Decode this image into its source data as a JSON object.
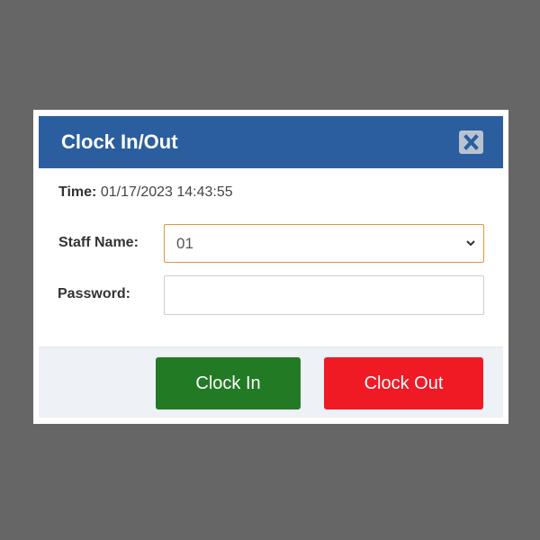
{
  "dialog": {
    "title": "Clock In/Out",
    "close_icon": "close-icon"
  },
  "time": {
    "label": "Time:",
    "value": "01/17/2023 14:43:55"
  },
  "staff": {
    "label": "Staff Name:",
    "selected": "01",
    "icon": "chevron-down-icon"
  },
  "password": {
    "label": "Password:",
    "value": "",
    "placeholder": ""
  },
  "actions": {
    "clock_in": "Clock In",
    "clock_out": "Clock Out"
  },
  "colors": {
    "header": "#2b5e9e",
    "clock_in": "#237a24",
    "clock_out": "#f01a25",
    "select_focus_border": "#e8943a",
    "backdrop": "#666666"
  }
}
